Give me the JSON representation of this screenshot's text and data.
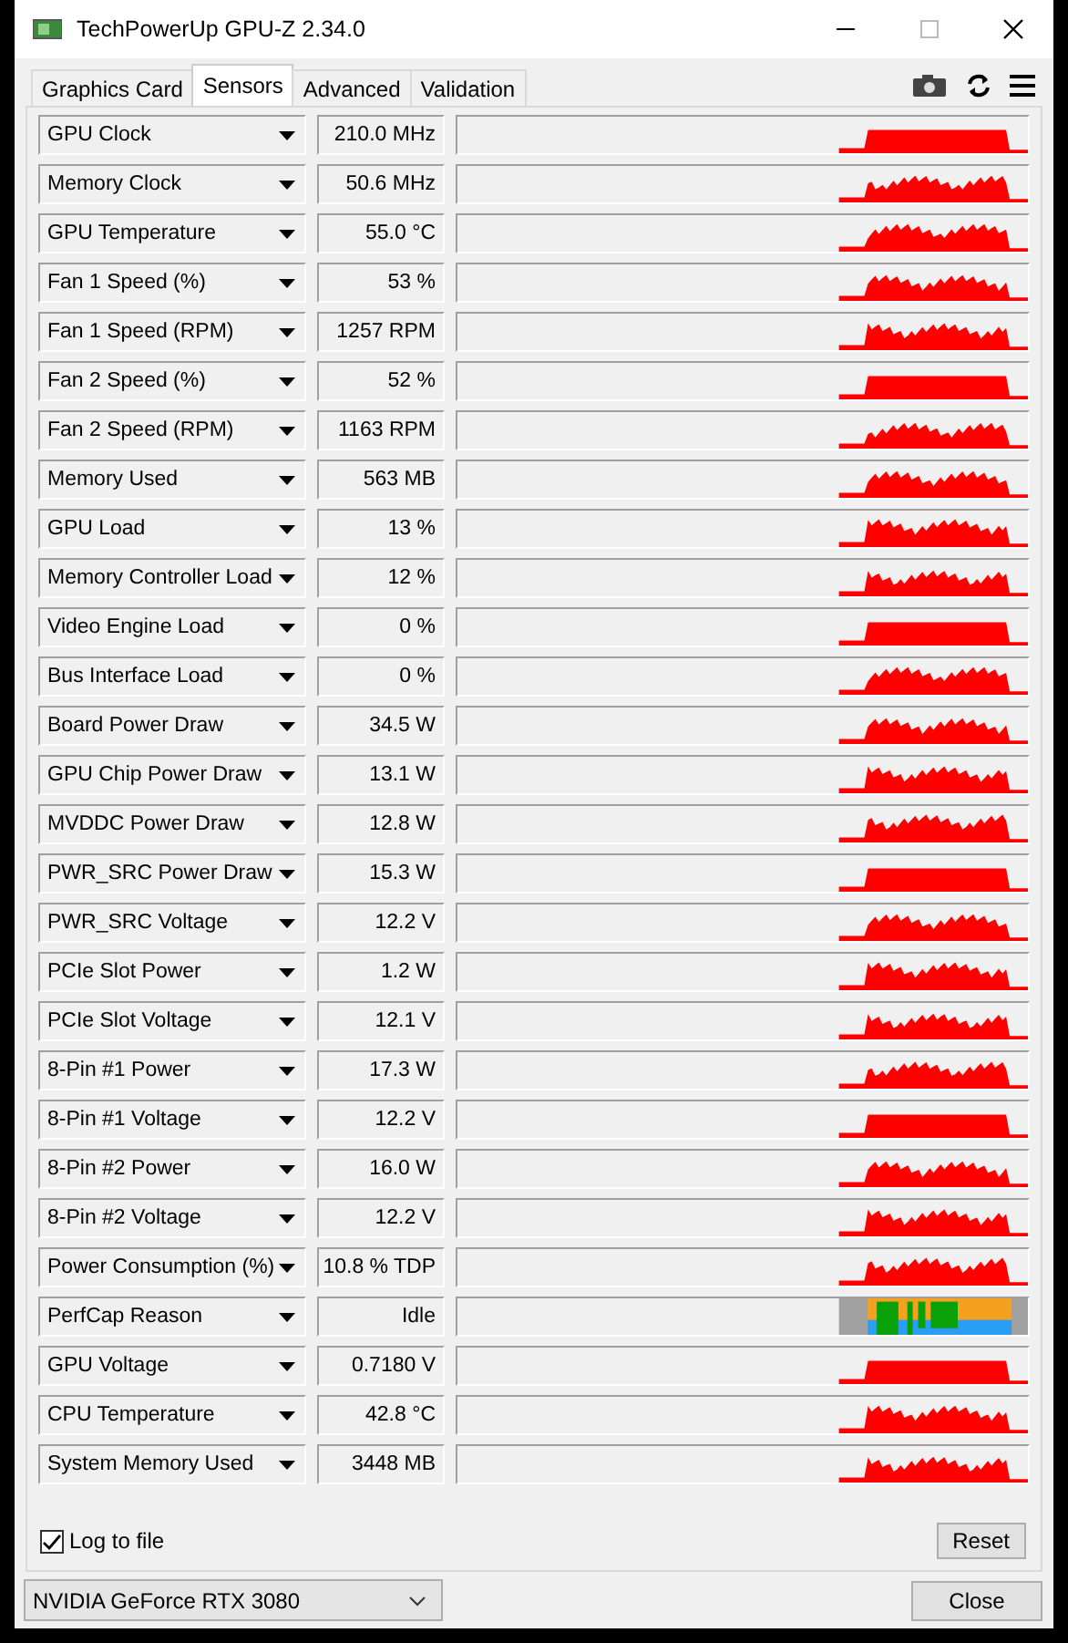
{
  "window": {
    "title": "TechPowerUp GPU-Z 2.34.0"
  },
  "tabs": [
    {
      "label": "Graphics Card",
      "selected": false
    },
    {
      "label": "Sensors",
      "selected": true
    },
    {
      "label": "Advanced",
      "selected": false
    },
    {
      "label": "Validation",
      "selected": false
    }
  ],
  "sensors": [
    {
      "name": "GPU Clock",
      "value": "210.0 MHz",
      "kind": "graph"
    },
    {
      "name": "Memory Clock",
      "value": "50.6 MHz",
      "kind": "graph"
    },
    {
      "name": "GPU Temperature",
      "value": "55.0 °C",
      "kind": "graph"
    },
    {
      "name": "Fan 1 Speed (%)",
      "value": "53 %",
      "kind": "graph"
    },
    {
      "name": "Fan 1 Speed (RPM)",
      "value": "1257 RPM",
      "kind": "graph"
    },
    {
      "name": "Fan 2 Speed (%)",
      "value": "52 %",
      "kind": "graph"
    },
    {
      "name": "Fan 2 Speed (RPM)",
      "value": "1163 RPM",
      "kind": "graph"
    },
    {
      "name": "Memory Used",
      "value": "563 MB",
      "kind": "graph"
    },
    {
      "name": "GPU Load",
      "value": "13 %",
      "kind": "graph"
    },
    {
      "name": "Memory Controller Load",
      "value": "12 %",
      "kind": "graph"
    },
    {
      "name": "Video Engine Load",
      "value": "0 %",
      "kind": "graph"
    },
    {
      "name": "Bus Interface Load",
      "value": "0 %",
      "kind": "graph"
    },
    {
      "name": "Board Power Draw",
      "value": "34.5 W",
      "kind": "graph"
    },
    {
      "name": "GPU Chip Power Draw",
      "value": "13.1 W",
      "kind": "graph"
    },
    {
      "name": "MVDDC Power Draw",
      "value": "12.8 W",
      "kind": "graph"
    },
    {
      "name": "PWR_SRC Power Draw",
      "value": "15.3 W",
      "kind": "graph"
    },
    {
      "name": "PWR_SRC Voltage",
      "value": "12.2 V",
      "kind": "graph"
    },
    {
      "name": "PCIe Slot Power",
      "value": "1.2 W",
      "kind": "graph"
    },
    {
      "name": "PCIe Slot Voltage",
      "value": "12.1 V",
      "kind": "graph"
    },
    {
      "name": "8-Pin #1 Power",
      "value": "17.3 W",
      "kind": "graph"
    },
    {
      "name": "8-Pin #1 Voltage",
      "value": "12.2 V",
      "kind": "graph"
    },
    {
      "name": "8-Pin #2 Power",
      "value": "16.0 W",
      "kind": "graph"
    },
    {
      "name": "8-Pin #2 Voltage",
      "value": "12.2 V",
      "kind": "graph"
    },
    {
      "name": "Power Consumption (%)",
      "value": "10.8 % TDP",
      "kind": "graph"
    },
    {
      "name": "PerfCap Reason",
      "value": "Idle",
      "kind": "status"
    },
    {
      "name": "GPU Voltage",
      "value": "0.7180 V",
      "kind": "graph"
    },
    {
      "name": "CPU Temperature",
      "value": "42.8 °C",
      "kind": "graph"
    },
    {
      "name": "System Memory Used",
      "value": "3448 MB",
      "kind": "graph"
    }
  ],
  "log_to_file": {
    "label": "Log to file",
    "checked": true
  },
  "reset_button": "Reset",
  "gpu_select": {
    "value": "NVIDIA GeForce RTX 3080"
  },
  "close_button": "Close"
}
